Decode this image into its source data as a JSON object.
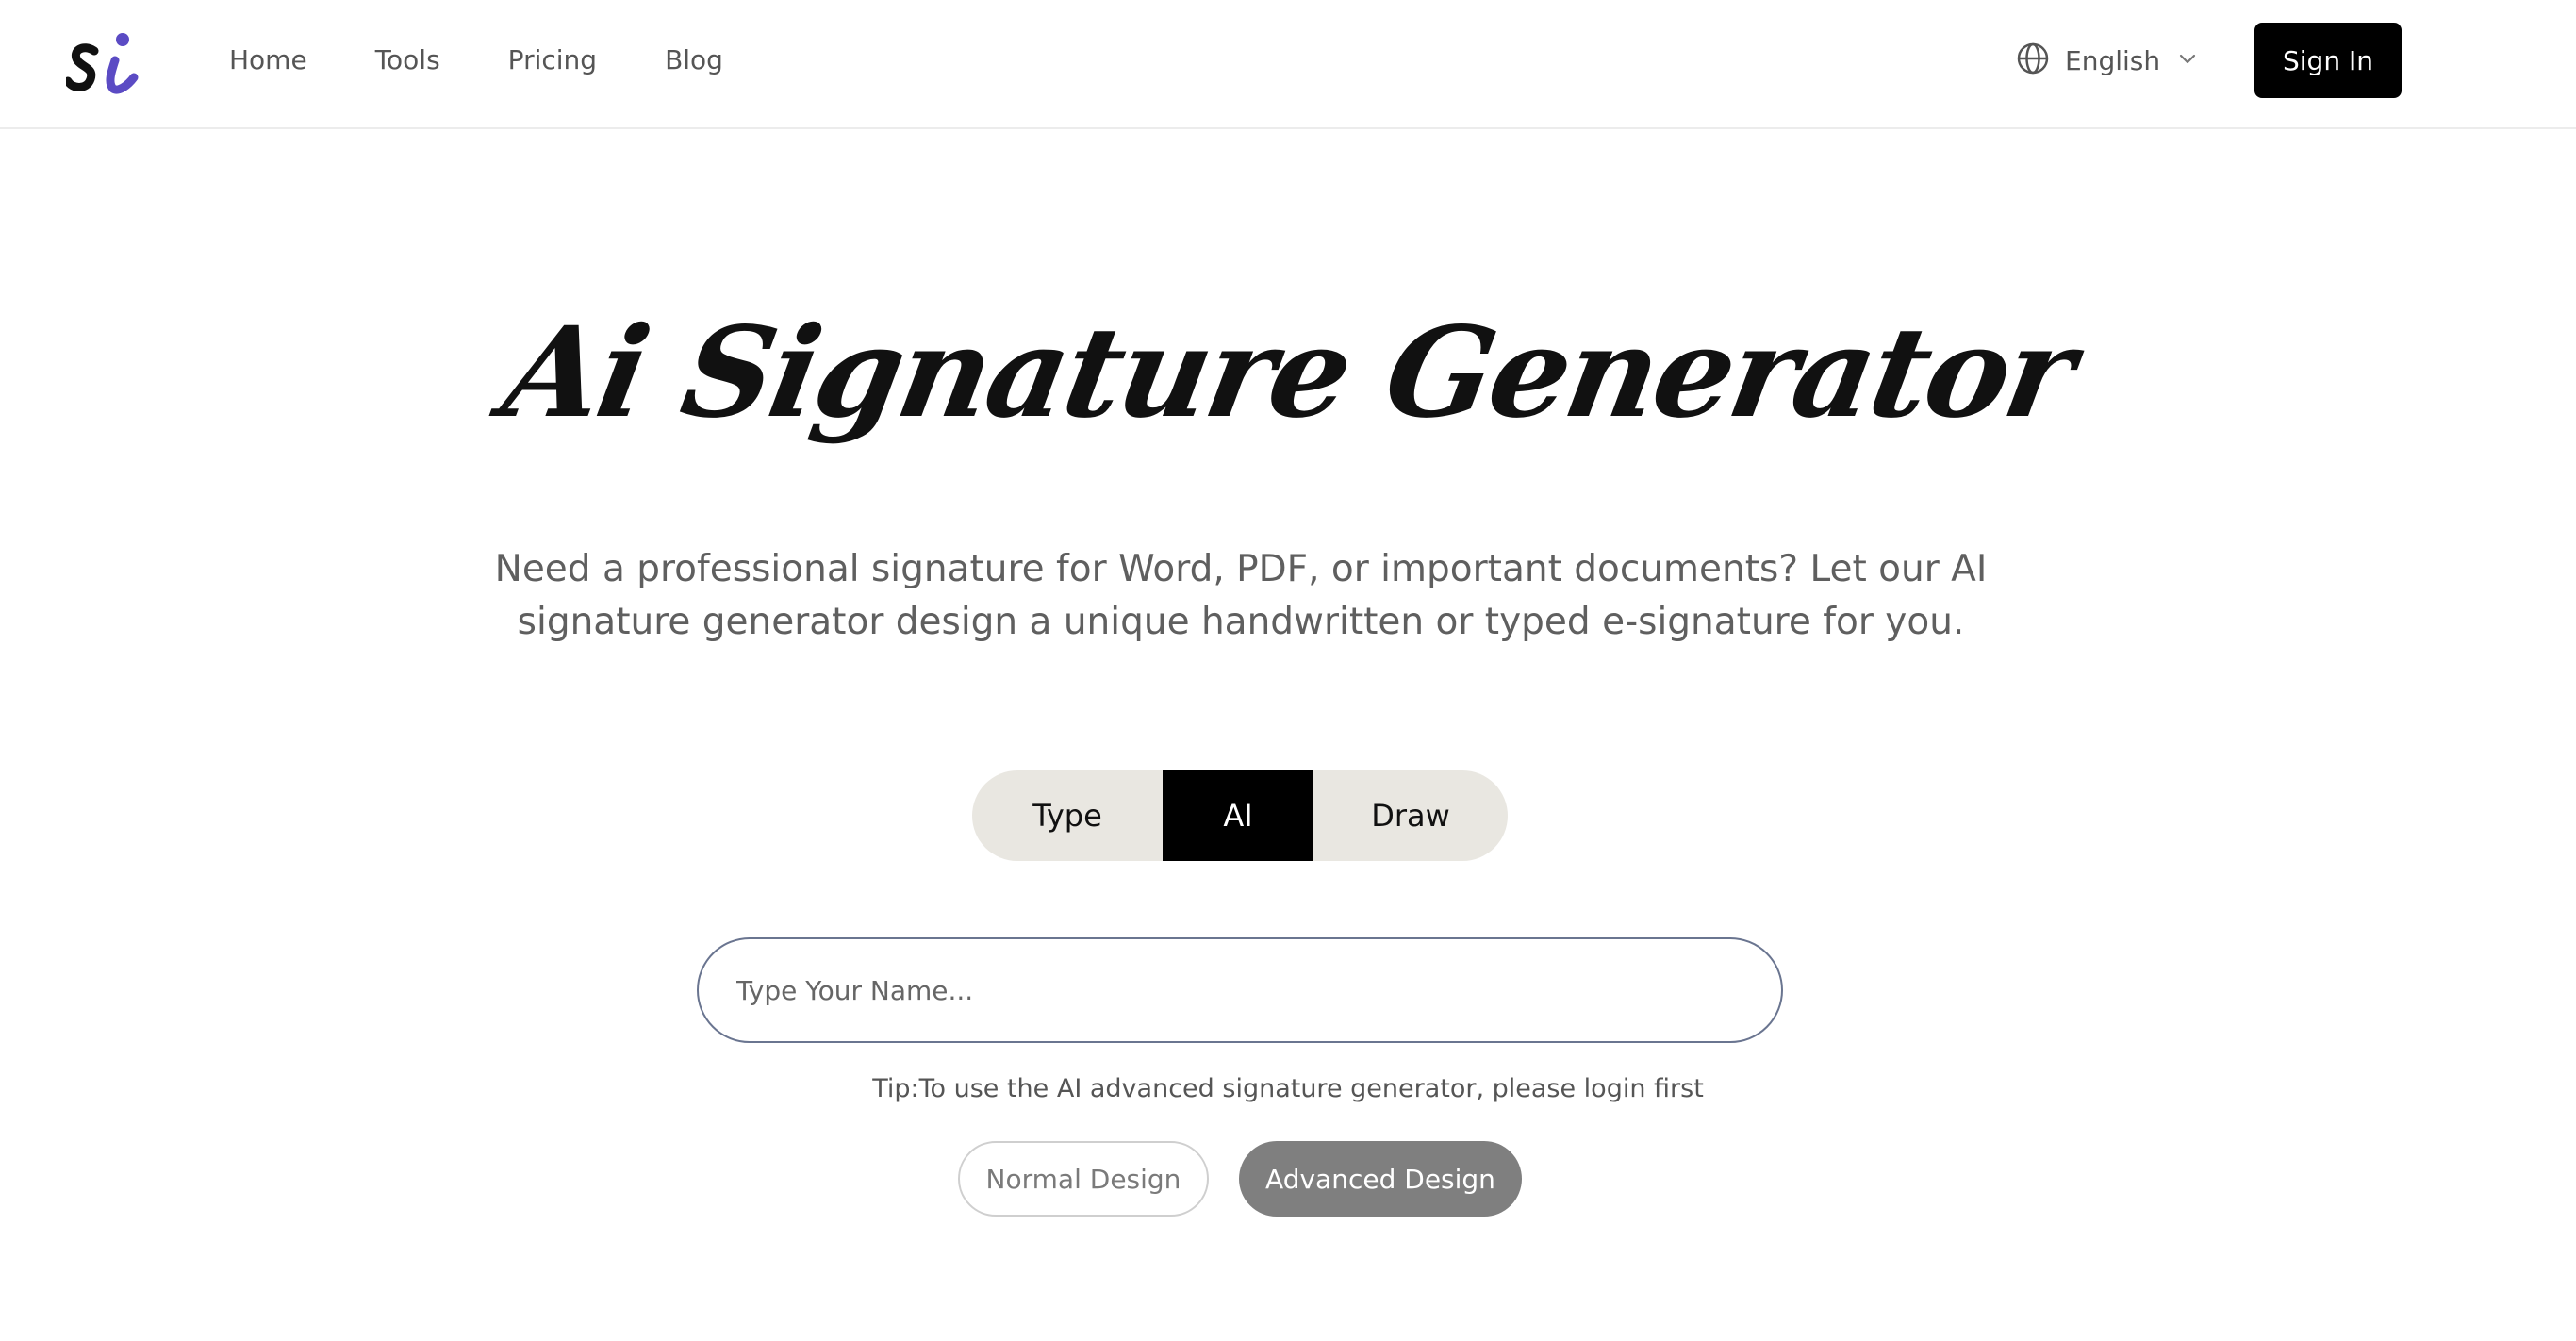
{
  "header": {
    "logo_icon": "si-logo-icon",
    "nav": [
      {
        "label": "Home"
      },
      {
        "label": "Tools"
      },
      {
        "label": "Pricing"
      },
      {
        "label": "Blog"
      }
    ],
    "language": {
      "icon": "globe-icon",
      "label": "English",
      "chevron_icon": "chevron-down-icon"
    },
    "sign_in_label": "Sign In"
  },
  "hero": {
    "title": "Ai Signature Generator",
    "subtitle": "Need a professional signature for Word, PDF, or important documents? Let our AI signature generator design a unique handwritten or typed e-signature for you."
  },
  "mode_toggle": {
    "options": [
      {
        "label": "Type"
      },
      {
        "label": "AI"
      },
      {
        "label": "Draw"
      }
    ],
    "selected": "AI"
  },
  "name_input": {
    "value": "",
    "placeholder": "Type Your Name..."
  },
  "tip": "Tip:To use the AI advanced signature generator, please login first",
  "design_buttons": {
    "normal_label": "Normal Design",
    "advanced_label": "Advanced Design"
  },
  "colors": {
    "accent_purple": "#5b4bc4",
    "primary_black": "#000000",
    "toggle_bg": "#e9e7e1",
    "advanced_btn_bg": "#7f7f7f"
  }
}
